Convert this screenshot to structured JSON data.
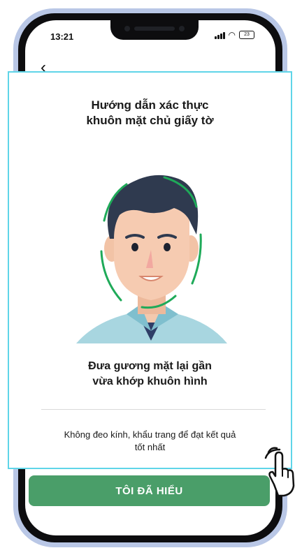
{
  "status_bar": {
    "time": "13:21",
    "battery": "23"
  },
  "guide": {
    "title_line1": "Hướng dẫn xác thực",
    "title_line2": "khuôn mặt chủ giấy tờ",
    "instruction_line1": "Đưa gương mặt lại gần",
    "instruction_line2": "vừa khớp khuôn hình",
    "tip_line1": "Không đeo kính, khẩu trang để đạt kết quả",
    "tip_line2": "tốt nhất"
  },
  "actions": {
    "understand_label": "TÔI ĐÃ HIỂU"
  },
  "icons": {
    "back": "chevron-left-icon",
    "signal": "signal-icon",
    "wifi": "wifi-icon",
    "battery": "battery-icon",
    "pointer": "pointer-hand-icon"
  },
  "colors": {
    "primary": "#4a9e69",
    "highlight": "#5fd5e8",
    "frame": "#1faa59"
  }
}
